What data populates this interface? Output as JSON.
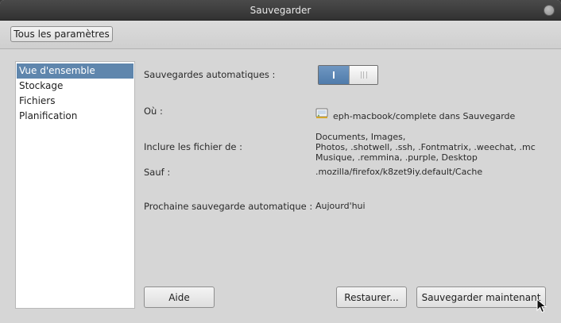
{
  "window": {
    "title": "Sauvegarder"
  },
  "toolbar": {
    "all_settings_label": "Tous les paramètres"
  },
  "sidebar": {
    "items": [
      {
        "label": "Vue d'ensemble",
        "selected": true
      },
      {
        "label": "Stockage",
        "selected": false
      },
      {
        "label": "Fichiers",
        "selected": false
      },
      {
        "label": "Planification",
        "selected": false
      }
    ]
  },
  "overview": {
    "auto_backups_label": "Sauvegardes automatiques :",
    "auto_backups_on": true,
    "where_label": "Où :",
    "where_value": "eph-macbook/complete dans Sauvegarde",
    "where_icon": "network-folder-icon",
    "include_label": "Inclure les fichier de :",
    "include_lines": [
      "Documents, Images,",
      "Photos, .shotwell, .ssh, .Fontmatrix, .weechat, .mc",
      "Musique, .remmina, .purple, Desktop"
    ],
    "except_label": "Sauf :",
    "except_value": ".mozilla/firefox/k8zet9iy.default/Cache",
    "next_label": "Prochaine sauvegarde automatique :",
    "next_value": "Aujourd'hui"
  },
  "buttons": {
    "help": "Aide",
    "restore": "Restaurer...",
    "backup_now": "Sauvegarder maintenant"
  },
  "colors": {
    "selection": "#5f86ad",
    "switch_on": "#4f7bab",
    "titlebar": "#3c3c3c"
  }
}
